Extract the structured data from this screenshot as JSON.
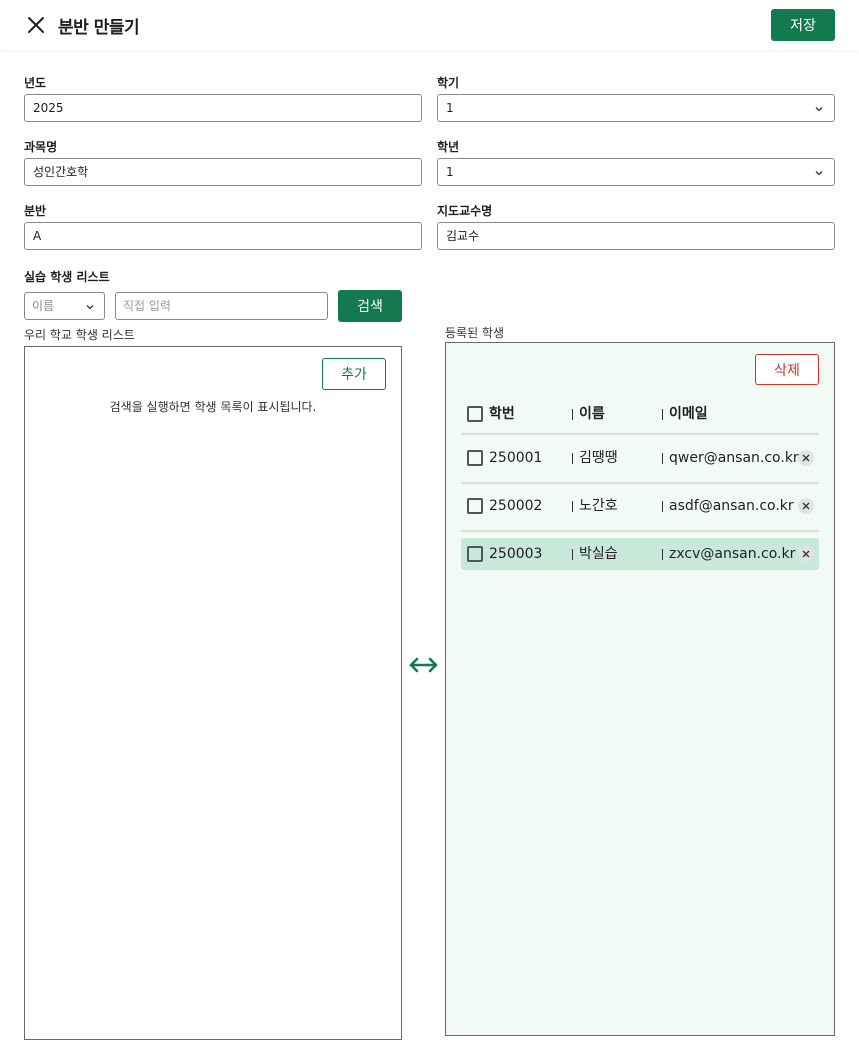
{
  "header": {
    "title": "분반 만들기",
    "save_label": "저장"
  },
  "form": {
    "year": {
      "label": "년도",
      "value": "2025"
    },
    "semester": {
      "label": "학기",
      "value": "1"
    },
    "course": {
      "label": "과목명",
      "value": "성인간호학"
    },
    "grade": {
      "label": "학년",
      "value": "1"
    },
    "section": {
      "label": "분반",
      "value": "A"
    },
    "professor": {
      "label": "지도교수명",
      "value": "김교수"
    }
  },
  "students": {
    "section_label": "실습 학생 리스트",
    "filter_value": "이름",
    "input_placeholder": "직접 입력",
    "search_label": "검색"
  },
  "left_panel": {
    "caption": "우리 학교 학생 리스트",
    "add_label": "추가",
    "empty_message": "검색을 실행하면 학생 목록이 표시됩니다."
  },
  "right_panel": {
    "caption": "등록된 학생",
    "delete_label": "삭제",
    "columns": [
      "학번",
      "이름",
      "이메일"
    ],
    "rows": [
      {
        "id": "250001",
        "name": "김땡땡",
        "email": "qwer@ansan.co.kr",
        "selected": false
      },
      {
        "id": "250002",
        "name": "노간호",
        "email": "asdf@ansan.co.kr",
        "selected": false
      },
      {
        "id": "250003",
        "name": "박실습",
        "email": "zxcv@ansan.co.kr",
        "selected": true
      }
    ]
  },
  "colors": {
    "primary": "#137a4f",
    "danger": "#c0392b",
    "selected_row": "#c8e9d9",
    "panel_bg": "#f2faf6"
  }
}
